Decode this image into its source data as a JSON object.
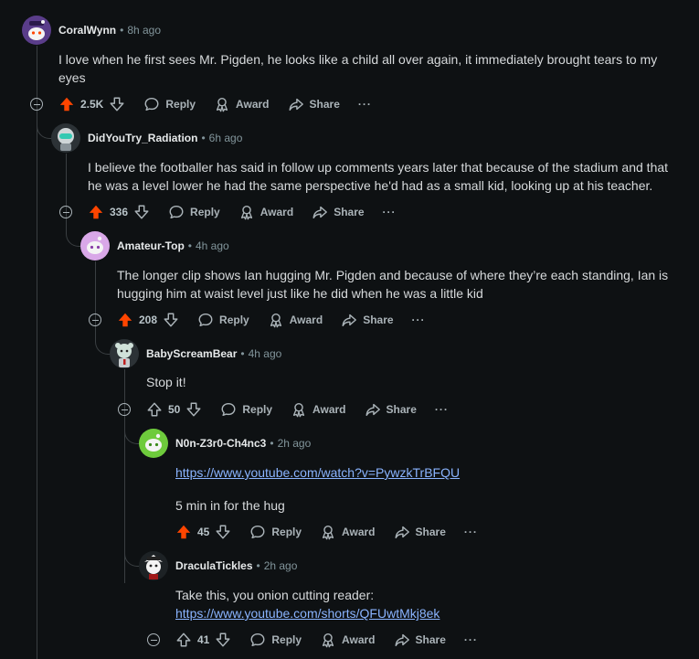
{
  "labels": {
    "reply": "Reply",
    "award": "Award",
    "share": "Share",
    "more": "···"
  },
  "colors": {
    "upvoted": "#ff4500",
    "link": "#8ab4ff"
  },
  "comments": [
    {
      "author": "CoralWynn",
      "time": "8h ago",
      "body": "I love when he first sees Mr. Pigden, he looks like a child all over again, it immediately brought tears to my eyes",
      "score": "2.5K",
      "upvoted": true
    },
    {
      "author": "DidYouTry_Radiation",
      "time": "6h ago",
      "body": "I believe the footballer has said in follow up comments years later that because of the stadium and that he was a level lower he had the same perspective he'd had as a small kid, looking up at his teacher.",
      "score": "336",
      "upvoted": true
    },
    {
      "author": "Amateur-Top",
      "time": "4h ago",
      "body": "The longer clip shows Ian hugging Mr. Pigden and because of where they’re each standing, Ian is hugging him at waist level just like he did when he was a little kid",
      "score": "208",
      "upvoted": true
    },
    {
      "author": "BabyScreamBear",
      "time": "4h ago",
      "body": "Stop it!",
      "score": "50",
      "upvoted": false
    },
    {
      "author": "N0n-Z3r0-Ch4nc3",
      "time": "2h ago",
      "link": "https://www.youtube.com/watch?v=PywzkTrBFQU",
      "body": "5 min in for the hug",
      "score": "45",
      "upvoted": true
    },
    {
      "author": "DraculaTickles",
      "time": "2h ago",
      "body": "Take this, you onion cutting reader:",
      "link": "https://www.youtube.com/shorts/QFUwtMkj8ek",
      "score": "41",
      "upvoted": false
    }
  ]
}
